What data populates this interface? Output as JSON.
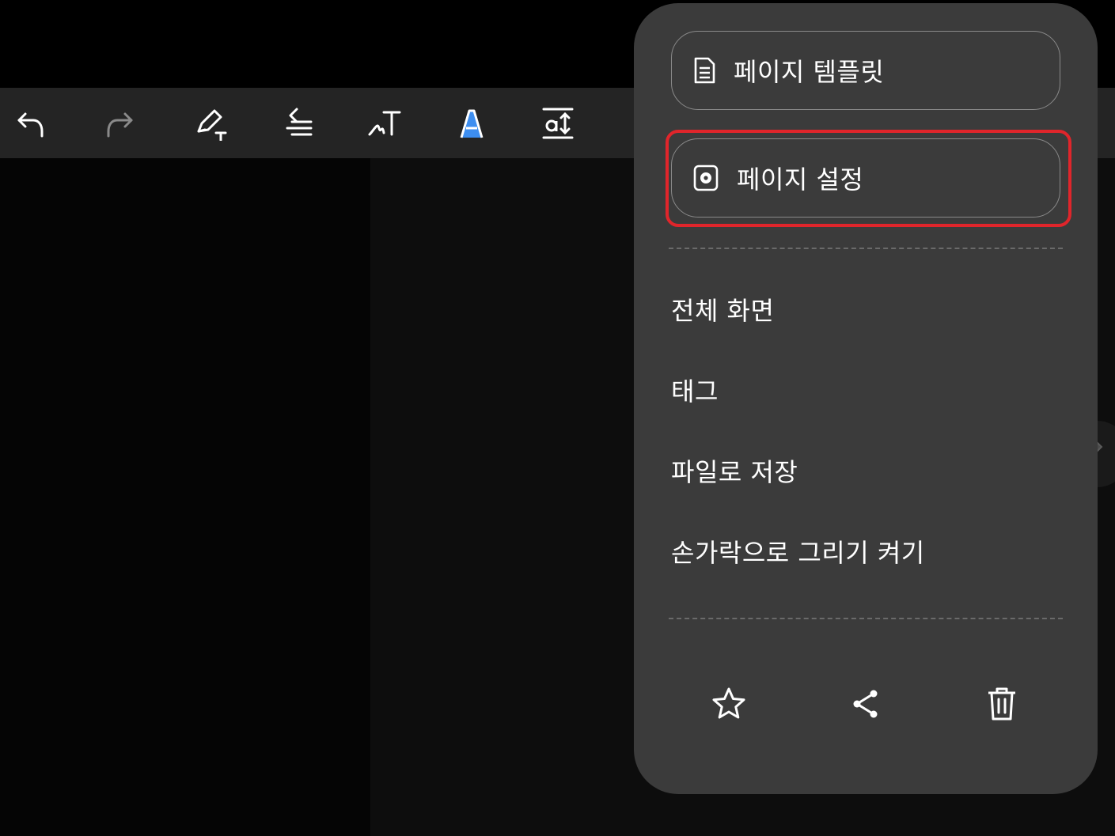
{
  "toolbar": {
    "tools": [
      {
        "icon": "undo-icon"
      },
      {
        "icon": "redo-icon"
      },
      {
        "icon": "pen-text-icon"
      },
      {
        "icon": "text-align-icon"
      },
      {
        "icon": "handwriting-to-text-icon"
      },
      {
        "icon": "text-style-icon"
      },
      {
        "icon": "text-spacing-icon"
      }
    ]
  },
  "menu": {
    "page_template_label": "페이지 템플릿",
    "page_settings_label": "페이지 설정",
    "items": [
      "전체 화면",
      "태그",
      "파일로 저장",
      "손가락으로 그리기 켜기"
    ],
    "bottom_actions": [
      "star-icon",
      "share-icon",
      "trash-icon"
    ]
  },
  "colors": {
    "highlight": "#e0252b",
    "menu_bg": "#3b3b3b",
    "text_style_accent": "#3d8ef0"
  }
}
